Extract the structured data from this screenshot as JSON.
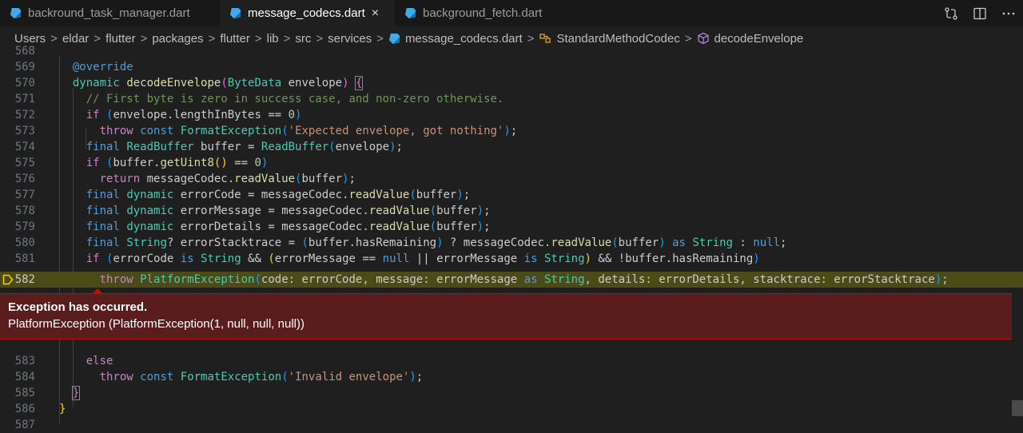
{
  "tabs": [
    {
      "label": "backround_task_manager.dart",
      "icon": "dart-icon"
    },
    {
      "label": "message_codecs.dart",
      "icon": "dart-icon",
      "close": "×"
    },
    {
      "label": "background_fetch.dart",
      "icon": "dart-icon"
    }
  ],
  "breadcrumb": [
    "Users",
    "eldar",
    "flutter",
    "packages",
    "flutter",
    "lib",
    "src",
    "services",
    "message_codecs.dart",
    "StandardMethodCodec",
    "decodeEnvelope"
  ],
  "breadcrumb_sep": ">",
  "lines": {
    "l568": "568",
    "l569": "569",
    "l570": "570",
    "l571": "571",
    "l572": "572",
    "l573": "573",
    "l574": "574",
    "l575": "575",
    "l576": "576",
    "l577": "577",
    "l578": "578",
    "l579": "579",
    "l580": "580",
    "l581": "581",
    "l582": "582",
    "l583": "583",
    "l584": "584",
    "l585": "585",
    "l586": "586",
    "l587": "587"
  },
  "exception": {
    "title": "Exception has occurred.",
    "detail": "PlatformException (PlatformException(1, null, null, null))"
  },
  "colors": {
    "accent": "#be1100",
    "highlight": "#4b4b18",
    "background": "#1f1f1f"
  }
}
